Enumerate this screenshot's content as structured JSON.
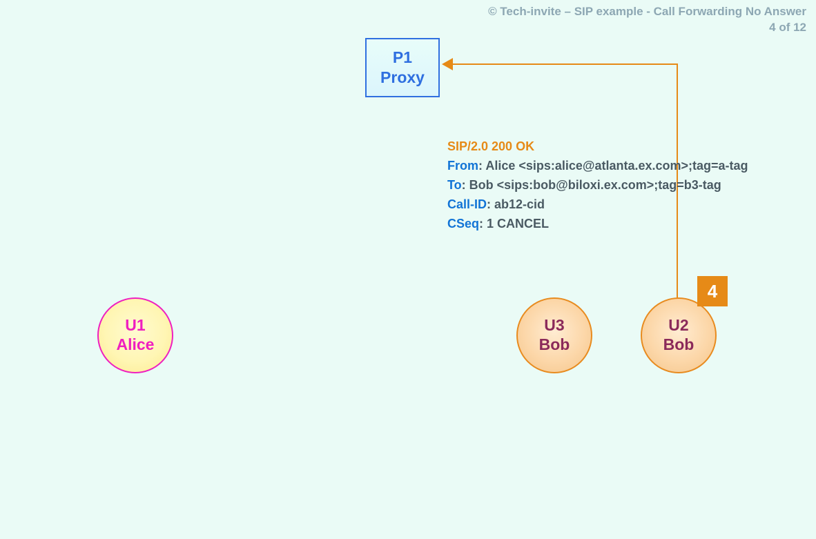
{
  "header": {
    "line1": "© Tech-invite – SIP example - Call Forwarding No Answer",
    "line2": "4 of 12"
  },
  "proxy": {
    "id": "P1",
    "label": "Proxy"
  },
  "nodes": {
    "u1": {
      "id": "U1",
      "name": "Alice"
    },
    "u3": {
      "id": "U3",
      "name": "Bob"
    },
    "u2": {
      "id": "U2",
      "name": "Bob"
    }
  },
  "step": {
    "number": "4"
  },
  "sip": {
    "status": "SIP/2.0 200 OK",
    "from_key": "From",
    "from_val": ": Alice <sips:alice@atlanta.ex.com>;tag=a-tag",
    "to_key": "To",
    "to_val": ": Bob <sips:bob@biloxi.ex.com>;tag=b3-tag",
    "callid_key": "Call-ID",
    "callid_val": ": ab12-cid",
    "cseq_key": "CSeq",
    "cseq_val": ": 1 CANCEL"
  }
}
